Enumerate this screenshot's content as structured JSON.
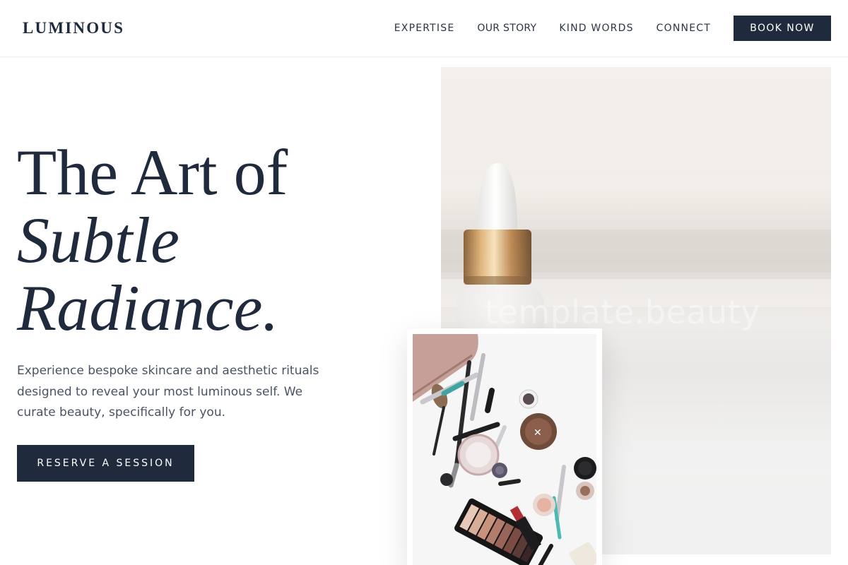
{
  "brand": {
    "logo": "LUMINOUS"
  },
  "nav": {
    "items": [
      {
        "label": "EXPERTISE"
      },
      {
        "label": "OUR STORY"
      },
      {
        "label": "KIND WORDS"
      },
      {
        "label": "CONNECT"
      }
    ],
    "cta_label": "BOOK NOW"
  },
  "hero": {
    "headline_line1": "The Art of",
    "headline_line2": "Subtle",
    "headline_line3": "Radiance.",
    "description": "Experience bespoke skincare and aesthetic rituals designed to reveal your most luminous self. We curate beauty, specifically for you.",
    "cta_label": "RESERVE A SESSION"
  },
  "media": {
    "main_watermark": "template.beauty"
  },
  "colors": {
    "navy": "#1f2a3d",
    "text_muted": "#4a5363",
    "background": "#ffffff"
  }
}
